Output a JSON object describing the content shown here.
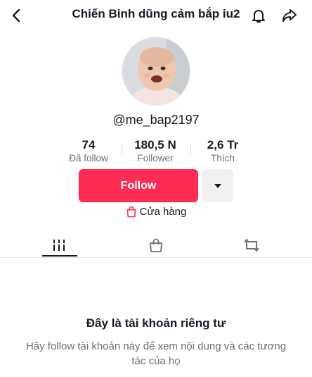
{
  "header": {
    "title": "Chiến Binh dũng cảm bắp iu2",
    "back_icon": "chevron-left-icon",
    "bell_icon": "bell-icon",
    "share_icon": "share-arrow-icon"
  },
  "profile": {
    "avatar_icon": "baby-avatar-photo",
    "username": "@me_bap2197"
  },
  "stats": [
    {
      "value": "74",
      "label": "Đã follow"
    },
    {
      "value": "180,5 N",
      "label": "Follower"
    },
    {
      "value": "2,6 Tr",
      "label": "Thích"
    }
  ],
  "actions": {
    "follow_label": "Follow",
    "follow_color": "#fe2c55",
    "dropdown_icon": "caret-down-icon"
  },
  "shop": {
    "icon": "shopping-bag-icon",
    "label": "Cửa hàng"
  },
  "tabs": [
    {
      "icon": "grid-icon",
      "active": true
    },
    {
      "icon": "bag-icon",
      "active": false
    },
    {
      "icon": "repost-icon",
      "active": false
    }
  ],
  "private": {
    "title": "Đây là tài khoản riêng tư",
    "description": "Hãy follow tài khoản này để xem nội dung và các tương tác của họ"
  }
}
